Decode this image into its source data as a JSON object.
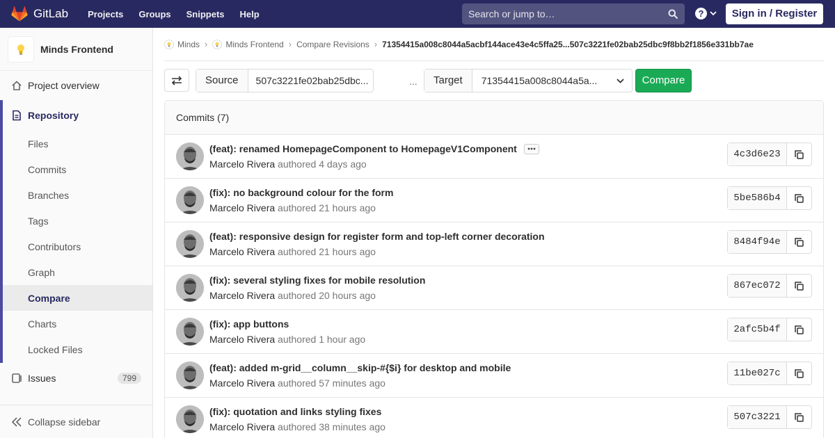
{
  "navbar": {
    "brand": "GitLab",
    "links": [
      "Projects",
      "Groups",
      "Snippets",
      "Help"
    ],
    "search_placeholder": "Search or jump to…",
    "help_glyph": "?",
    "signin_label": "Sign in / Register",
    "colors": {
      "background": "#292961",
      "logo": "#fc6d26"
    }
  },
  "sidebar": {
    "project_name": "Minds Frontend",
    "overview_label": "Project overview",
    "repository_label": "Repository",
    "repository_items": [
      "Files",
      "Commits",
      "Branches",
      "Tags",
      "Contributors",
      "Graph",
      "Compare",
      "Charts",
      "Locked Files"
    ],
    "active_item": "Compare",
    "issues_label": "Issues",
    "issues_count": "799",
    "collapse_label": "Collapse sidebar"
  },
  "breadcrumb": {
    "items": [
      "Minds",
      "Minds Frontend",
      "Compare Revisions"
    ],
    "current": "71354415a008c8044a5acbf144ace43e4c5ffa25...507c3221fe02bab25dbc9f8bb2f1856e331bb7ae"
  },
  "compare": {
    "source_label": "Source",
    "source_value": "507c3221fe02bab25dbc...",
    "dots": "...",
    "target_label": "Target",
    "target_value": "71354415a008c8044a5a...",
    "button_label": "Compare",
    "button_color": "#1aaa55"
  },
  "commits": {
    "header": "Commits (7)",
    "authored_word": "authored",
    "items": [
      {
        "title": "(feat): renamed HomepageComponent to HomepageV1Component",
        "author": "Marcelo Rivera",
        "time": "4 days ago",
        "sha": "4c3d6e23",
        "has_ellipsis": true
      },
      {
        "title": "(fix): no background colour for the form",
        "author": "Marcelo Rivera",
        "time": "21 hours ago",
        "sha": "5be586b4",
        "has_ellipsis": false
      },
      {
        "title": "(feat): responsive design for register form and top-left corner decoration",
        "author": "Marcelo Rivera",
        "time": "21 hours ago",
        "sha": "8484f94e",
        "has_ellipsis": false
      },
      {
        "title": "(fix): several styling fixes for mobile resolution",
        "author": "Marcelo Rivera",
        "time": "20 hours ago",
        "sha": "867ec072",
        "has_ellipsis": false
      },
      {
        "title": "(fix): app buttons",
        "author": "Marcelo Rivera",
        "time": "1 hour ago",
        "sha": "2afc5b4f",
        "has_ellipsis": false
      },
      {
        "title": "(feat): added m-grid__column__skip-#{$i} for desktop and mobile",
        "author": "Marcelo Rivera",
        "time": "57 minutes ago",
        "sha": "11be027c",
        "has_ellipsis": false
      },
      {
        "title": "(fix): quotation and links styling fixes",
        "author": "Marcelo Rivera",
        "time": "38 minutes ago",
        "sha": "507c3221",
        "has_ellipsis": false
      }
    ]
  },
  "icons": {
    "logo": "gitlab-tanuki-icon",
    "search": "search-icon",
    "help": "question-circle-icon",
    "overview": "home-icon",
    "repository": "document-icon",
    "issues": "issues-icon",
    "collapse": "double-chevron-left-icon",
    "swap": "swap-arrows-icon",
    "copy": "copy-icon",
    "dropdown": "chevron-down-icon",
    "project": "lightbulb-icon"
  }
}
